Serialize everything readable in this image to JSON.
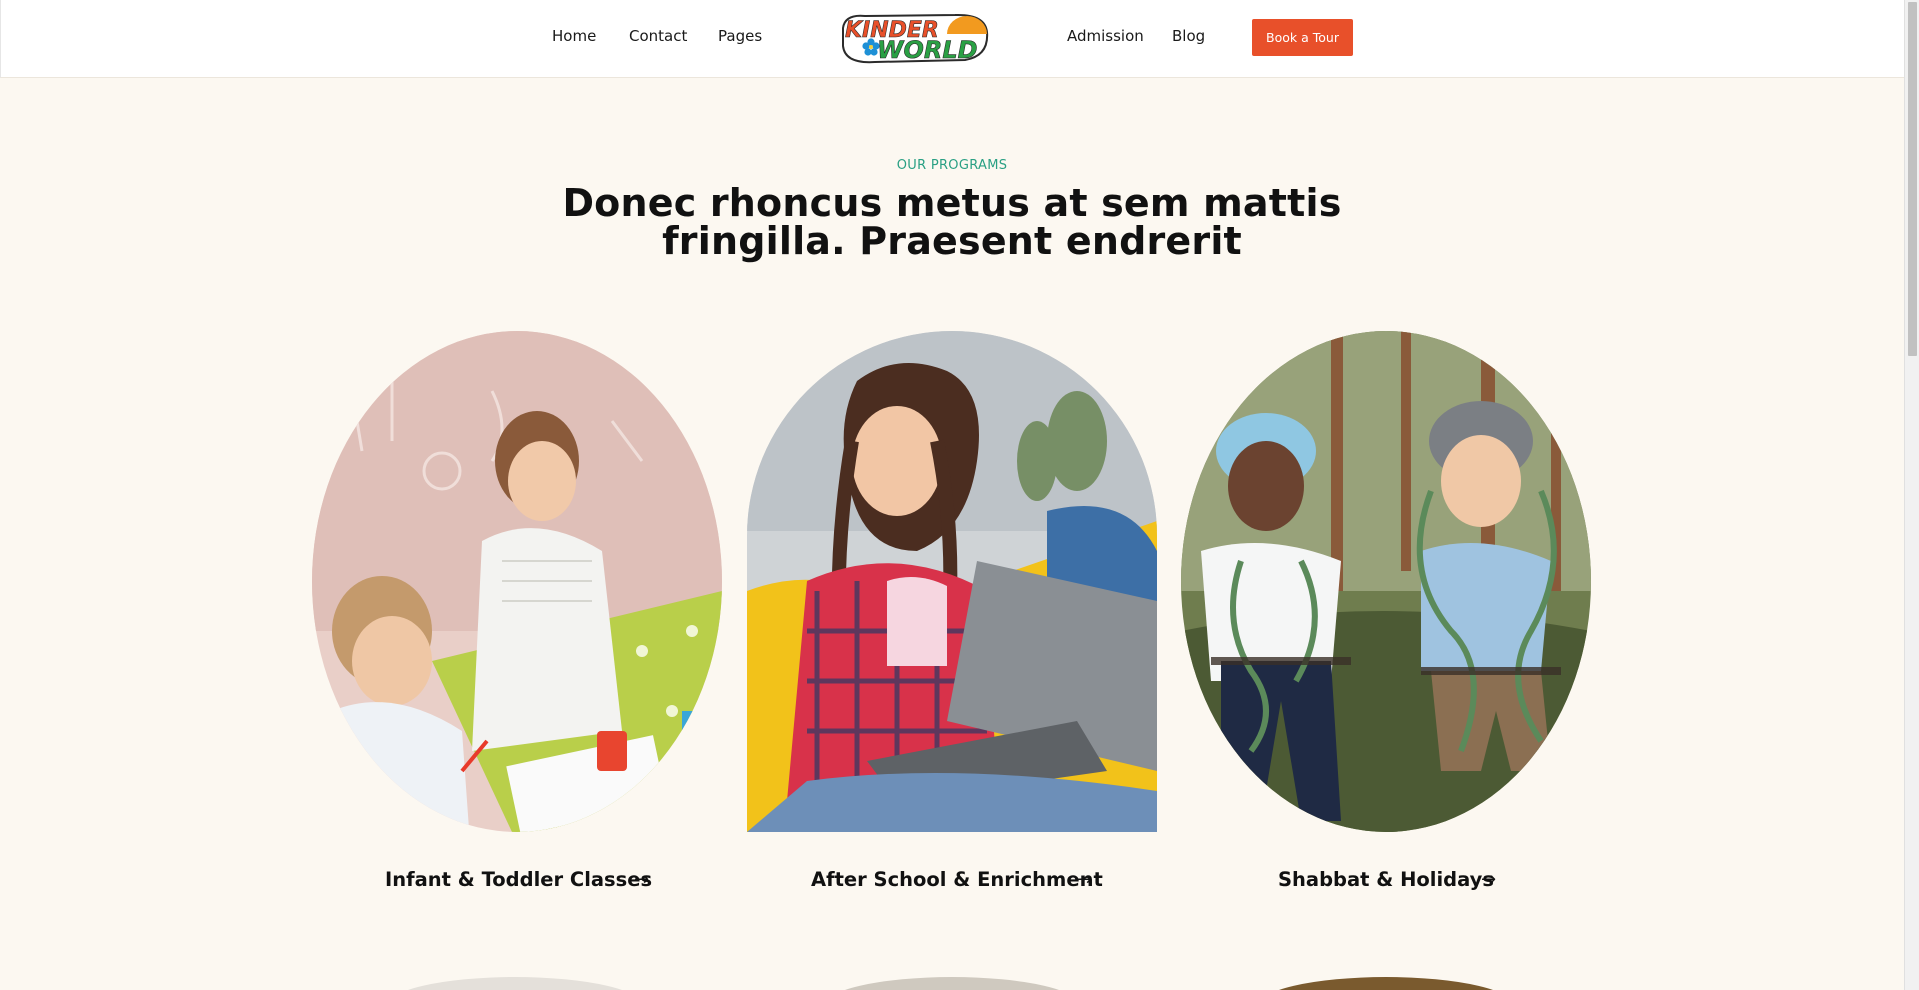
{
  "nav": {
    "home": "Home",
    "contact": "Contact",
    "pages": "Pages",
    "admission": "Admission",
    "blog": "Blog",
    "cta": "Book a Tour"
  },
  "logo": {
    "line1": "KINDER",
    "line2": "WORLD"
  },
  "section": {
    "eyebrow": "OUR PROGRAMS",
    "title": "Donec rhoncus metus at sem mattis fringilla. Praesent endrerit"
  },
  "programs": [
    {
      "label": "Infant & Toddler Classes",
      "arrow": "→"
    },
    {
      "label": "After School & Enrichment",
      "arrow": "→"
    },
    {
      "label": "Shabbat & Holidays",
      "arrow": "→"
    }
  ],
  "colors": {
    "accent": "#e8502a",
    "eyebrow": "#2aa084",
    "background": "#fcf8f1"
  }
}
